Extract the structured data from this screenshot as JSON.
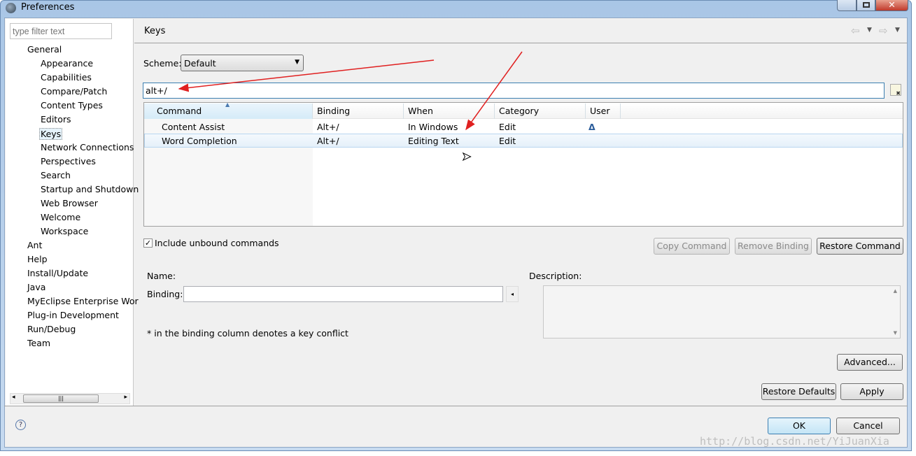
{
  "window": {
    "title": "Preferences"
  },
  "sidebar": {
    "filter_placeholder": "type filter text",
    "items": [
      {
        "label": "General",
        "level": 0
      },
      {
        "label": "Appearance",
        "level": 1
      },
      {
        "label": "Capabilities",
        "level": 1
      },
      {
        "label": "Compare/Patch",
        "level": 1
      },
      {
        "label": "Content Types",
        "level": 1
      },
      {
        "label": "Editors",
        "level": 1
      },
      {
        "label": "Keys",
        "level": 1,
        "selected": true
      },
      {
        "label": "Network Connections",
        "level": 1
      },
      {
        "label": "Perspectives",
        "level": 1
      },
      {
        "label": "Search",
        "level": 1
      },
      {
        "label": "Startup and Shutdown",
        "level": 1
      },
      {
        "label": "Web Browser",
        "level": 1
      },
      {
        "label": "Welcome",
        "level": 1
      },
      {
        "label": "Workspace",
        "level": 1
      },
      {
        "label": "Ant",
        "level": 0
      },
      {
        "label": "Help",
        "level": 0
      },
      {
        "label": "Install/Update",
        "level": 0
      },
      {
        "label": "Java",
        "level": 0
      },
      {
        "label": "MyEclipse Enterprise Wor",
        "level": 0
      },
      {
        "label": "Plug-in Development",
        "level": 0
      },
      {
        "label": "Run/Debug",
        "level": 0
      },
      {
        "label": "Team",
        "level": 0
      }
    ]
  },
  "page": {
    "title": "Keys",
    "scheme_label": "Scheme:",
    "scheme_value": "Default",
    "search_value": "alt+/"
  },
  "table": {
    "columns": [
      "Command",
      "Binding",
      "When",
      "Category",
      "User"
    ],
    "rows": [
      {
        "command": "Content Assist",
        "binding": "Alt+/",
        "when": "In Windows",
        "category": "Edit",
        "user": "Δ"
      },
      {
        "command": "Word Completion",
        "binding": "Alt+/",
        "when": "Editing Text",
        "category": "Edit",
        "user": ""
      }
    ]
  },
  "include_unbound": {
    "label": "Include unbound commands",
    "checked": true
  },
  "buttons": {
    "copy": "Copy Command",
    "remove": "Remove Binding",
    "restore_cmd": "Restore Command",
    "advanced": "Advanced...",
    "restore_defaults": "Restore Defaults",
    "apply": "Apply",
    "ok": "OK",
    "cancel": "Cancel"
  },
  "details": {
    "name_label": "Name:",
    "binding_label": "Binding:",
    "description_label": "Description:",
    "conflict_note": "* in the binding column denotes a key conflict"
  },
  "watermark": "http://blog.csdn.net/YiJuanXia",
  "colors": {
    "annotation_arrow": "#e02020",
    "selection": "#e5f3fb",
    "focus_border": "#3c7fb1"
  }
}
